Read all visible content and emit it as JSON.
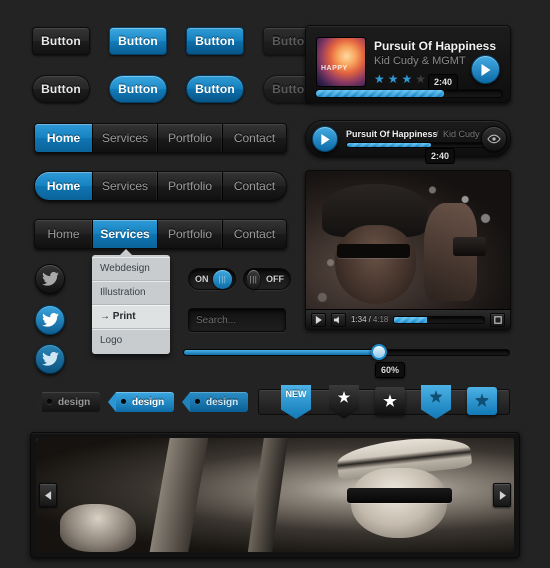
{
  "buttons": {
    "row1": [
      {
        "label": "Button",
        "style": "dark"
      },
      {
        "label": "Button",
        "style": "blue"
      },
      {
        "label": "Button",
        "style": "blue2"
      },
      {
        "label": "Button",
        "style": "disabled"
      }
    ],
    "row2": [
      {
        "label": "Button",
        "style": "dark"
      },
      {
        "label": "Button",
        "style": "blue"
      },
      {
        "label": "Button",
        "style": "blue2"
      },
      {
        "label": "Button",
        "style": "disabled"
      }
    ]
  },
  "navs": [
    {
      "items": [
        "Home",
        "Services",
        "Portfolio",
        "Contact"
      ],
      "active": 0,
      "shape": "square"
    },
    {
      "items": [
        "Home",
        "Services",
        "Portfolio",
        "Contact"
      ],
      "active": 0,
      "shape": "pill"
    },
    {
      "items": [
        "Home",
        "Services",
        "Portfolio",
        "Contact"
      ],
      "active": 1,
      "shape": "square"
    }
  ],
  "dropdown": {
    "items": [
      {
        "label": "Webdesign",
        "highlighted": false
      },
      {
        "label": "Illustration",
        "highlighted": false
      },
      {
        "label": "→ Print",
        "highlighted": true
      },
      {
        "label": "Logo",
        "highlighted": false
      }
    ]
  },
  "social": [
    {
      "name": "twitter-dark"
    },
    {
      "name": "twitter-blue"
    },
    {
      "name": "twitter-blue-dark"
    }
  ],
  "toggles": [
    {
      "label": "ON",
      "state": "on"
    },
    {
      "label": "OFF",
      "state": "off"
    }
  ],
  "search": {
    "value": "",
    "placeholder": "Search...",
    "button_icon": "search-icon"
  },
  "slider": {
    "value": 60,
    "tooltip": "60%"
  },
  "tags": [
    {
      "label": "design",
      "style": "dark"
    },
    {
      "label": "design",
      "style": "blue"
    },
    {
      "label": "design",
      "style": "blue2"
    }
  ],
  "badges": [
    {
      "label": "NEW",
      "shape": "ribbon",
      "color": "blue"
    },
    {
      "label": "★",
      "shape": "ribbon",
      "color": "dark"
    },
    {
      "label": "★",
      "shape": "square",
      "color": "dark"
    },
    {
      "label": "★",
      "shape": "ribbon",
      "color": "blue"
    },
    {
      "label": "★",
      "shape": "square",
      "color": "blue"
    }
  ],
  "music_player": {
    "title": "Pursuit Of Happiness",
    "artist": "Kid Cudy & MGMT",
    "rating": 3,
    "rating_max": 5,
    "time": "2:40",
    "progress": 68,
    "album_art_text": "HAPPY",
    "play_icon": "play-icon"
  },
  "compact_player": {
    "title": "Pursuit Of Happiness",
    "separator": "/",
    "artist": "Kid Cudy",
    "time": "2:40",
    "progress": 60,
    "play_icon": "play-icon",
    "eye_icon": "eye-icon"
  },
  "video_player": {
    "play_icon": "play-icon",
    "volume_icon": "volume-icon",
    "current_time": "1:34",
    "time_separator": "/",
    "duration": "4:18",
    "progress": 36,
    "fullscreen_icon": "fullscreen-icon"
  },
  "carousel": {
    "prev_icon": "chevron-left-icon",
    "next_icon": "chevron-right-icon"
  },
  "colors": {
    "background": "#232323",
    "accent_blue": "#1e8ccb",
    "accent_blue_dark": "#0a5f95",
    "text_light": "#e8e8e8",
    "text_muted": "#8a8a8a"
  }
}
